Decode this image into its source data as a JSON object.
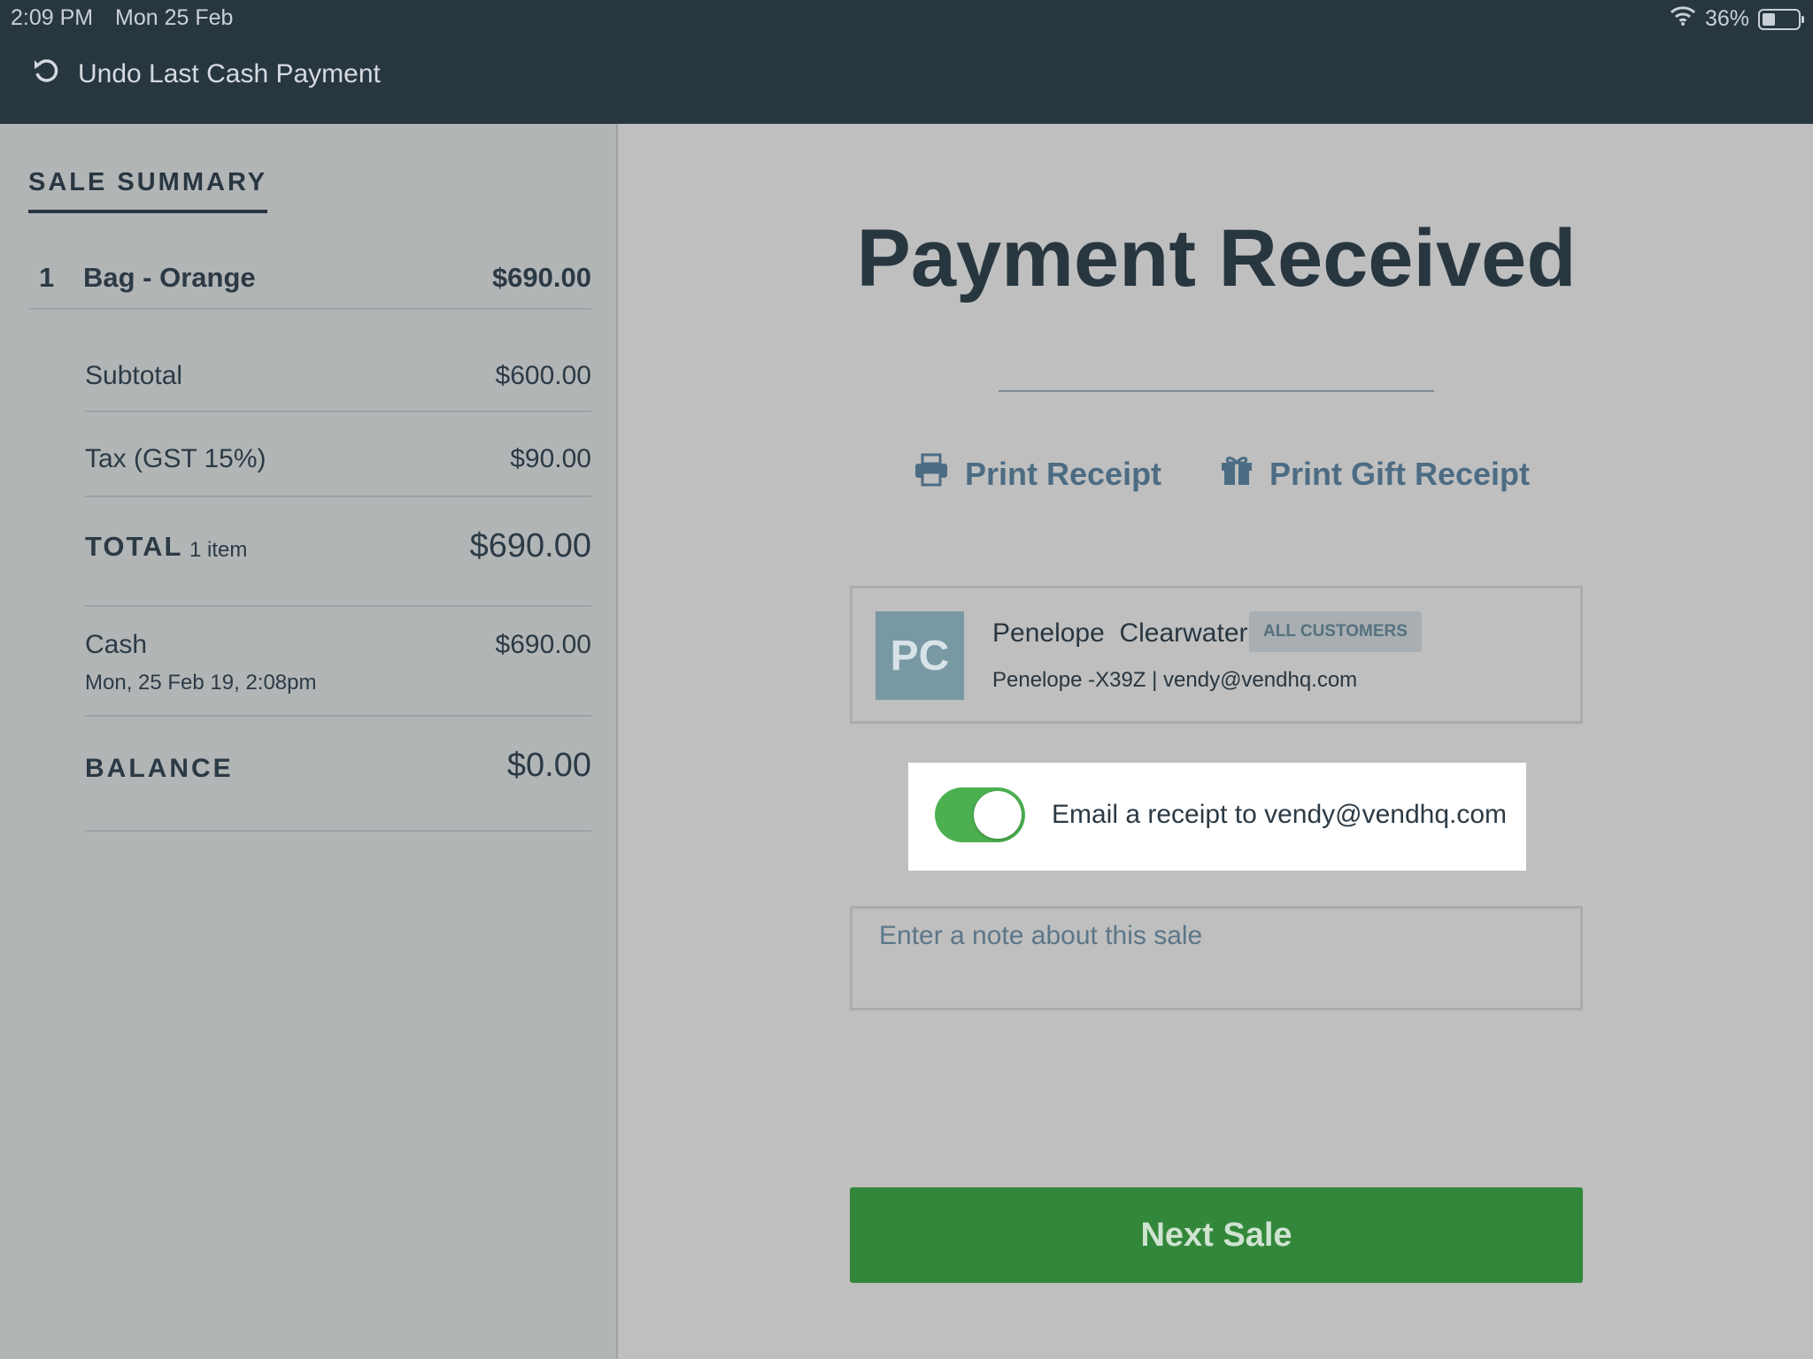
{
  "status_bar": {
    "time": "2:09 PM",
    "date": "Mon 25 Feb",
    "battery": "36%"
  },
  "header": {
    "undo_label": "Undo Last Cash Payment"
  },
  "sale_summary": {
    "title": "SALE SUMMARY",
    "line_item": {
      "qty": "1",
      "name": "Bag - Orange",
      "price": "$690.00"
    },
    "subtotal": {
      "label": "Subtotal",
      "value": "$600.00"
    },
    "tax": {
      "label": "Tax (GST 15%)",
      "value": "$90.00"
    },
    "total": {
      "label": "TOTAL",
      "count": "1 item",
      "value": "$690.00"
    },
    "payment": {
      "method": "Cash",
      "date": "Mon, 25 Feb 19, 2:08pm",
      "value": "$690.00"
    },
    "balance": {
      "label": "BALANCE",
      "value": "$0.00"
    }
  },
  "main": {
    "title": "Payment Received",
    "print_receipt": "Print Receipt",
    "print_gift_receipt": "Print Gift Receipt",
    "customer": {
      "initials": "PC",
      "name": "Penelope  Clearwater",
      "group": "ALL CUSTOMERS",
      "detail": "Penelope -X39Z | vendy@vendhq.com"
    },
    "email_toggle": {
      "on": true,
      "label": "Email a receipt to vendy@vendhq.com"
    },
    "note": {
      "placeholder": "Enter a note about this sale",
      "value": ""
    },
    "next_sale": "Next Sale"
  },
  "colors": {
    "header_bg": "#283640",
    "sidebar_bg": "#b2b5b6",
    "main_bg": "#bfbfbf",
    "accent_blue": "#4c6c84",
    "toggle_green": "#4cb050",
    "button_green": "#33873a"
  },
  "icons": [
    "wifi-icon",
    "battery-icon",
    "undo-icon",
    "printer-icon",
    "gift-icon"
  ]
}
